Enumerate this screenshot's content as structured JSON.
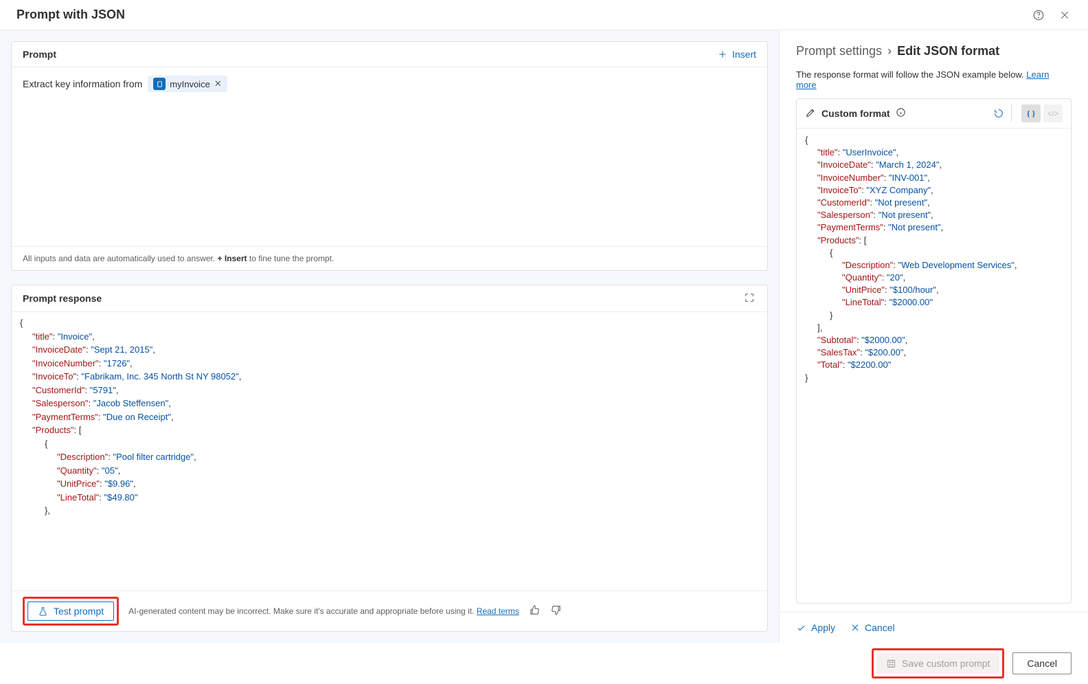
{
  "header": {
    "title": "Prompt with JSON"
  },
  "prompt": {
    "section_label": "Prompt",
    "insert_label": "Insert",
    "text": "Extract key information from",
    "chip_label": "myInvoice",
    "footer_pre": "All inputs and data are automatically used to answer. ",
    "footer_bold": "+ Insert",
    "footer_post": " to fine tune the prompt."
  },
  "response": {
    "section_label": "Prompt response",
    "test_label": "Test prompt",
    "disclaimer": "AI-generated content may be incorrect. Make sure it's accurate and appropriate before using it. ",
    "read_terms": "Read terms",
    "json_lines": [
      {
        "indent": 0,
        "tokens": [
          {
            "t": "pun",
            "v": "{"
          }
        ]
      },
      {
        "indent": 1,
        "tokens": [
          {
            "t": "key",
            "v": "\"title\""
          },
          {
            "t": "pun",
            "v": ": "
          },
          {
            "t": "str",
            "v": "\"Invoice\""
          },
          {
            "t": "pun",
            "v": ","
          }
        ]
      },
      {
        "indent": 1,
        "tokens": [
          {
            "t": "key",
            "v": "\"InvoiceDate\""
          },
          {
            "t": "pun",
            "v": ": "
          },
          {
            "t": "str",
            "v": "\"Sept 21, 2015\""
          },
          {
            "t": "pun",
            "v": ","
          }
        ]
      },
      {
        "indent": 1,
        "tokens": [
          {
            "t": "key",
            "v": "\"InvoiceNumber\""
          },
          {
            "t": "pun",
            "v": ": "
          },
          {
            "t": "str",
            "v": "\"1726\""
          },
          {
            "t": "pun",
            "v": ","
          }
        ]
      },
      {
        "indent": 1,
        "tokens": [
          {
            "t": "key",
            "v": "\"InvoiceTo\""
          },
          {
            "t": "pun",
            "v": ": "
          },
          {
            "t": "str",
            "v": "\"Fabrikam, Inc. 345 North St NY 98052\""
          },
          {
            "t": "pun",
            "v": ","
          }
        ]
      },
      {
        "indent": 1,
        "tokens": [
          {
            "t": "key",
            "v": "\"CustomerId\""
          },
          {
            "t": "pun",
            "v": ": "
          },
          {
            "t": "str",
            "v": "\"5791\""
          },
          {
            "t": "pun",
            "v": ","
          }
        ]
      },
      {
        "indent": 1,
        "tokens": [
          {
            "t": "key",
            "v": "\"Salesperson\""
          },
          {
            "t": "pun",
            "v": ": "
          },
          {
            "t": "str",
            "v": "\"Jacob Steffensen\""
          },
          {
            "t": "pun",
            "v": ","
          }
        ]
      },
      {
        "indent": 1,
        "tokens": [
          {
            "t": "key",
            "v": "\"PaymentTerms\""
          },
          {
            "t": "pun",
            "v": ": "
          },
          {
            "t": "str",
            "v": "\"Due on Receipt\""
          },
          {
            "t": "pun",
            "v": ","
          }
        ]
      },
      {
        "indent": 1,
        "tokens": [
          {
            "t": "key",
            "v": "\"Products\""
          },
          {
            "t": "pun",
            "v": ": ["
          }
        ]
      },
      {
        "indent": 2,
        "tokens": [
          {
            "t": "pun",
            "v": "{"
          }
        ]
      },
      {
        "indent": 3,
        "tokens": [
          {
            "t": "key",
            "v": "\"Description\""
          },
          {
            "t": "pun",
            "v": ": "
          },
          {
            "t": "str",
            "v": "\"Pool filter cartridge\""
          },
          {
            "t": "pun",
            "v": ","
          }
        ]
      },
      {
        "indent": 3,
        "tokens": [
          {
            "t": "key",
            "v": "\"Quantity\""
          },
          {
            "t": "pun",
            "v": ": "
          },
          {
            "t": "str",
            "v": "\"05\""
          },
          {
            "t": "pun",
            "v": ","
          }
        ]
      },
      {
        "indent": 3,
        "tokens": [
          {
            "t": "key",
            "v": "\"UnitPrice\""
          },
          {
            "t": "pun",
            "v": ": "
          },
          {
            "t": "str",
            "v": "\"$9.96\""
          },
          {
            "t": "pun",
            "v": ","
          }
        ]
      },
      {
        "indent": 3,
        "tokens": [
          {
            "t": "key",
            "v": "\"LineTotal\""
          },
          {
            "t": "pun",
            "v": ": "
          },
          {
            "t": "str",
            "v": "\"$49.80\""
          }
        ]
      },
      {
        "indent": 2,
        "tokens": [
          {
            "t": "pun",
            "v": "},"
          }
        ]
      }
    ]
  },
  "settings": {
    "crumb1": "Prompt settings",
    "crumb2": "Edit JSON format",
    "desc": "The response format will follow the JSON example below. ",
    "learn_more": "Learn more",
    "format_label": "Custom format",
    "apply_label": "Apply",
    "cancel_label": "Cancel",
    "json_lines": [
      {
        "indent": 0,
        "tokens": [
          {
            "t": "pun",
            "v": "{"
          }
        ]
      },
      {
        "indent": 1,
        "tokens": [
          {
            "t": "key",
            "v": "\"title\""
          },
          {
            "t": "pun",
            "v": ": "
          },
          {
            "t": "str",
            "v": "\"UserInvoice\""
          },
          {
            "t": "pun",
            "v": ","
          }
        ]
      },
      {
        "indent": 1,
        "tokens": [
          {
            "t": "key",
            "v": "\"InvoiceDate\""
          },
          {
            "t": "pun",
            "v": ": "
          },
          {
            "t": "str",
            "v": "\"March 1, 2024\""
          },
          {
            "t": "pun",
            "v": ","
          }
        ]
      },
      {
        "indent": 1,
        "tokens": [
          {
            "t": "key",
            "v": "\"InvoiceNumber\""
          },
          {
            "t": "pun",
            "v": ": "
          },
          {
            "t": "str",
            "v": "\"INV-001\""
          },
          {
            "t": "pun",
            "v": ","
          }
        ]
      },
      {
        "indent": 1,
        "tokens": [
          {
            "t": "key",
            "v": "\"InvoiceTo\""
          },
          {
            "t": "pun",
            "v": ": "
          },
          {
            "t": "str",
            "v": "\"XYZ Company\""
          },
          {
            "t": "pun",
            "v": ","
          }
        ]
      },
      {
        "indent": 1,
        "tokens": [
          {
            "t": "key",
            "v": "\"CustomerId\""
          },
          {
            "t": "pun",
            "v": ": "
          },
          {
            "t": "str",
            "v": "\"Not present\""
          },
          {
            "t": "pun",
            "v": ","
          }
        ]
      },
      {
        "indent": 1,
        "tokens": [
          {
            "t": "key",
            "v": "\"Salesperson\""
          },
          {
            "t": "pun",
            "v": ": "
          },
          {
            "t": "str",
            "v": "\"Not present\""
          },
          {
            "t": "pun",
            "v": ","
          }
        ]
      },
      {
        "indent": 1,
        "tokens": [
          {
            "t": "key",
            "v": "\"PaymentTerms\""
          },
          {
            "t": "pun",
            "v": ": "
          },
          {
            "t": "str",
            "v": "\"Not present\""
          },
          {
            "t": "pun",
            "v": ","
          }
        ]
      },
      {
        "indent": 1,
        "tokens": [
          {
            "t": "key",
            "v": "\"Products\""
          },
          {
            "t": "pun",
            "v": ": ["
          }
        ]
      },
      {
        "indent": 2,
        "tokens": [
          {
            "t": "pun",
            "v": "{"
          }
        ]
      },
      {
        "indent": 3,
        "tokens": [
          {
            "t": "key",
            "v": "\"Description\""
          },
          {
            "t": "pun",
            "v": ": "
          },
          {
            "t": "str",
            "v": "\"Web Development Services\""
          },
          {
            "t": "pun",
            "v": ","
          }
        ]
      },
      {
        "indent": 3,
        "tokens": [
          {
            "t": "key",
            "v": "\"Quantity\""
          },
          {
            "t": "pun",
            "v": ": "
          },
          {
            "t": "str",
            "v": "\"20\""
          },
          {
            "t": "pun",
            "v": ","
          }
        ]
      },
      {
        "indent": 3,
        "tokens": [
          {
            "t": "key",
            "v": "\"UnitPrice\""
          },
          {
            "t": "pun",
            "v": ": "
          },
          {
            "t": "str",
            "v": "\"$100/hour\""
          },
          {
            "t": "pun",
            "v": ","
          }
        ]
      },
      {
        "indent": 3,
        "tokens": [
          {
            "t": "key",
            "v": "\"LineTotal\""
          },
          {
            "t": "pun",
            "v": ": "
          },
          {
            "t": "str",
            "v": "\"$2000.00\""
          }
        ]
      },
      {
        "indent": 2,
        "tokens": [
          {
            "t": "pun",
            "v": "}"
          }
        ]
      },
      {
        "indent": 1,
        "tokens": [
          {
            "t": "pun",
            "v": "],"
          }
        ]
      },
      {
        "indent": 1,
        "tokens": [
          {
            "t": "key",
            "v": "\"Subtotal\""
          },
          {
            "t": "pun",
            "v": ": "
          },
          {
            "t": "str",
            "v": "\"$2000.00\""
          },
          {
            "t": "pun",
            "v": ","
          }
        ]
      },
      {
        "indent": 1,
        "tokens": [
          {
            "t": "key",
            "v": "\"SalesTax\""
          },
          {
            "t": "pun",
            "v": ": "
          },
          {
            "t": "str",
            "v": "\"$200.00\""
          },
          {
            "t": "pun",
            "v": ","
          }
        ]
      },
      {
        "indent": 1,
        "tokens": [
          {
            "t": "key",
            "v": "\"Total\""
          },
          {
            "t": "pun",
            "v": ": "
          },
          {
            "t": "str",
            "v": "\"$2200.00\""
          }
        ]
      },
      {
        "indent": 0,
        "tokens": [
          {
            "t": "pun",
            "v": "}"
          }
        ]
      }
    ]
  },
  "footer": {
    "save_label": "Save custom prompt",
    "cancel_label": "Cancel"
  }
}
